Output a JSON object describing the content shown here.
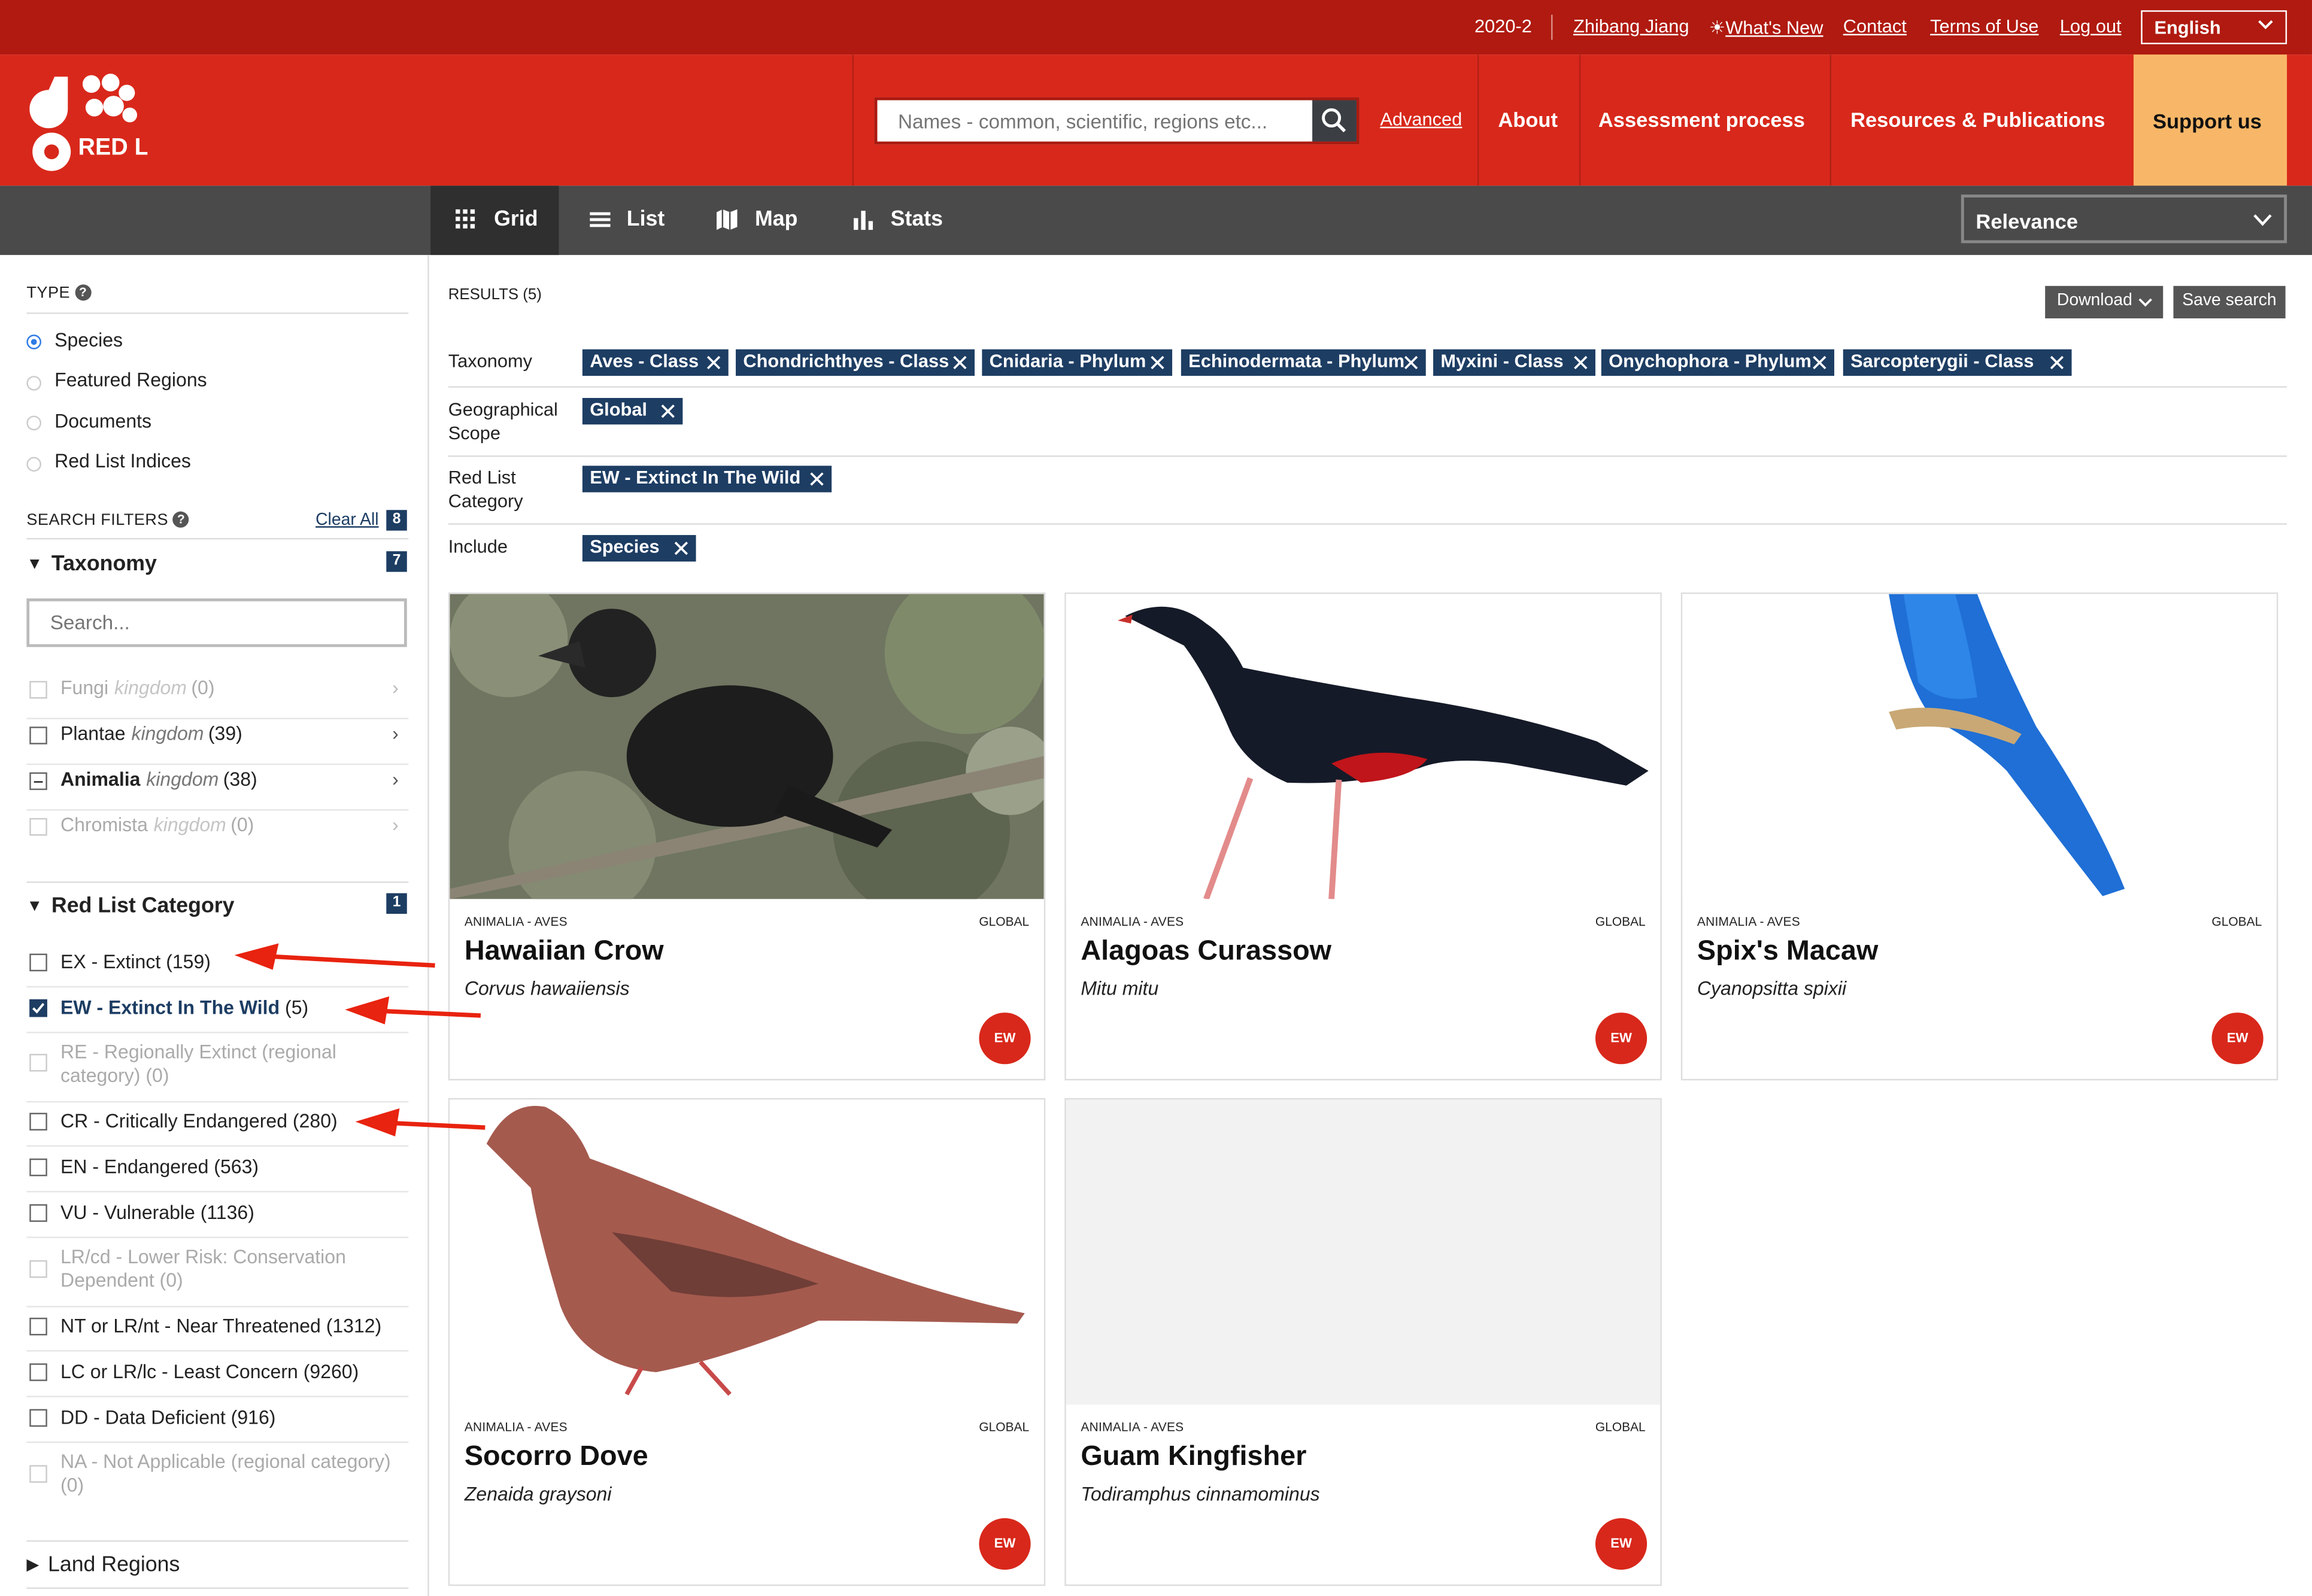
{
  "topbar": {
    "version": "2020-2",
    "user": "Zhibang Jiang",
    "whats_new": "What's New",
    "contact": "Contact",
    "terms": "Terms of Use",
    "logout": "Log out",
    "language": "English"
  },
  "header": {
    "logo_text": "RED LIST",
    "search_placeholder": "Names - common, scientific, regions etc...",
    "advanced": "Advanced",
    "nav": [
      "About",
      "Assessment process",
      "Resources & Publications"
    ],
    "support": "Support us"
  },
  "viewbar": {
    "tabs": [
      "Grid",
      "List",
      "Map",
      "Stats"
    ],
    "active_tab": "Grid",
    "sort": "Relevance"
  },
  "sidebar": {
    "type_heading": "TYPE",
    "type_options": [
      "Species",
      "Featured Regions",
      "Documents",
      "Red List Indices"
    ],
    "type_selected": "Species",
    "filters_heading": "SEARCH FILTERS",
    "clear_all": "Clear All",
    "filters_count": "8",
    "taxonomy": {
      "title": "Taxonomy",
      "count": "7",
      "search_placeholder": "Search...",
      "items": [
        {
          "name": "Fungi",
          "rank": "kingdom",
          "count": "(0)"
        },
        {
          "name": "Plantae",
          "rank": "kingdom",
          "count": "(39)"
        },
        {
          "name": "Animalia",
          "rank": "kingdom",
          "count": "(38)"
        },
        {
          "name": "Chromista",
          "rank": "kingdom",
          "count": "(0)"
        }
      ]
    },
    "red_list": {
      "title": "Red List Category",
      "count": "1",
      "items": [
        {
          "label": "EX - Extinct",
          "count": "(159)"
        },
        {
          "label": "EW - Extinct In The Wild",
          "count": "(5)"
        },
        {
          "label": "RE - Regionally Extinct (regional category) (0)"
        },
        {
          "label": "CR - Critically Endangered (280)"
        },
        {
          "label": "EN - Endangered (563)"
        },
        {
          "label": "VU - Vulnerable (1136)"
        },
        {
          "label": "LR/cd - Lower Risk: Conservation Dependent (0)"
        },
        {
          "label": "NT or LR/nt - Near Threatened (1312)"
        },
        {
          "label": "LC or LR/lc - Least Concern (9260)"
        },
        {
          "label": "DD - Data Deficient (916)"
        },
        {
          "label": "NA - Not Applicable (regional category) (0)"
        }
      ]
    },
    "land_regions": "Land Regions"
  },
  "main": {
    "results": "RESULTS (5)",
    "download": "Download",
    "save_search": "Save search",
    "filters": {
      "taxonomy_label": "Taxonomy",
      "taxonomy_chips": [
        "Aves - Class",
        "Chondrichthyes - Class",
        "Cnidaria - Phylum",
        "Echinodermata - Phylum",
        "Myxini - Class",
        "Onychophora - Phylum",
        "Sarcopterygii - Class"
      ],
      "geo_label": "Geographical Scope",
      "geo_chips": [
        "Global"
      ],
      "category_label": "Red List Category",
      "category_chips": [
        "EW - Extinct In The Wild"
      ],
      "include_label": "Include",
      "include_chips": [
        "Species"
      ]
    },
    "cards": [
      {
        "taxonomy": "ANIMALIA - AVES",
        "scope": "GLOBAL",
        "name": "Hawaiian Crow",
        "scientific": "Corvus hawaiiensis",
        "badge": "EW"
      },
      {
        "taxonomy": "ANIMALIA - AVES",
        "scope": "GLOBAL",
        "name": "Alagoas Curassow",
        "scientific": "Mitu mitu",
        "badge": "EW"
      },
      {
        "taxonomy": "ANIMALIA - AVES",
        "scope": "GLOBAL",
        "name": "Spix's Macaw",
        "scientific": "Cyanopsitta spixii",
        "badge": "EW"
      },
      {
        "taxonomy": "ANIMALIA - AVES",
        "scope": "GLOBAL",
        "name": "Socorro Dove",
        "scientific": "Zenaida graysoni",
        "badge": "EW"
      },
      {
        "taxonomy": "ANIMALIA - AVES",
        "scope": "GLOBAL",
        "name": "Guam Kingfisher",
        "scientific": "Todiramphus cinnamominus",
        "badge": "EW"
      }
    ]
  },
  "colors": {
    "brand_red": "#d8281b",
    "dark_red": "#b01a10",
    "navy": "#1d3d63",
    "support": "#f8b768",
    "annotation_arrow": "#e8230f"
  }
}
